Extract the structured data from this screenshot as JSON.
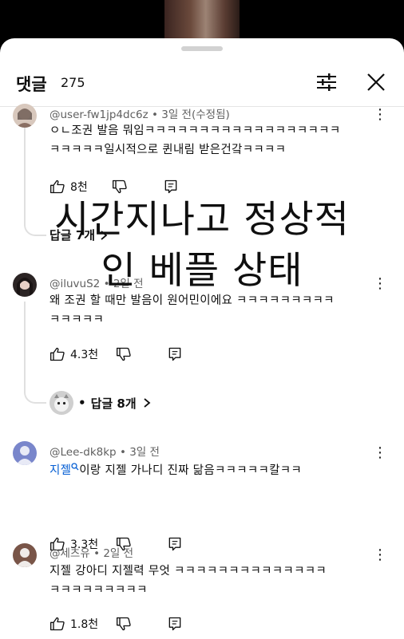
{
  "header": {
    "title": "댓글",
    "count": "275"
  },
  "comments": [
    {
      "author": "@user-fw1jp4dc6z",
      "time": "3일 전(수정됨)",
      "text_line1": "ㅇㄴ조권 발음 뭐임ㅋㅋㅋㅋㅋㅋㅋㅋㅋㅋㅋㅋㅋㅋㅋㅋㅋㅋ",
      "text_line2": "ㅋㅋㅋㅋㅋ일시적으로 퀸내림 받은건갘ㅋㅋㅋㅋ",
      "likes": "8천",
      "replies": "답글 7개"
    },
    {
      "author": "@iluvuS2",
      "time": "2일 전",
      "text_line1": "왜 조권 할 때만 발음이 원어민이에요 ㅋㅋㅋㅋㅋㅋㅋㅋㅋ",
      "text_line2": "ㅋㅋㅋㅋㅋ",
      "likes": "4.3천",
      "replies": "답글 8개"
    },
    {
      "author": "@Lee-dk8kp",
      "time": "3일 전",
      "hashtag": "지젤",
      "text_line1": "이랑 지젤 가나디 진짜 닮음ㅋㅋㅋㅋㅋ칼ㅋㅋ",
      "likes": "3.3천"
    },
    {
      "author": "@세츠유",
      "time": "2일 전",
      "text_line1": "지젤 강아디 지젤력 무엇 ㅋㅋㅋㅋㅋㅋㅋㅋㅋㅋㅋㅋㅋㅋ",
      "text_line2": "ㅋㅋㅋㅋㅋㅋㅋㅋㅋ",
      "likes": "1.8천"
    }
  ],
  "overlay": {
    "line1": "시간지나고 정상적",
    "line2": "인 베플 상태"
  },
  "separator": "•",
  "icons": {
    "like": "thumbs-up-icon",
    "dislike": "thumbs-down-icon",
    "reply": "reply-icon",
    "menu": "more-vertical-icon",
    "filter": "filter-sliders-icon",
    "close": "close-icon",
    "search": "search-icon",
    "chevron": "chevron-right-icon"
  },
  "colors": {
    "hashtag": "#065fd4",
    "meta": "#606060",
    "sheet": "#ffffff",
    "backdrop": "#000000"
  }
}
